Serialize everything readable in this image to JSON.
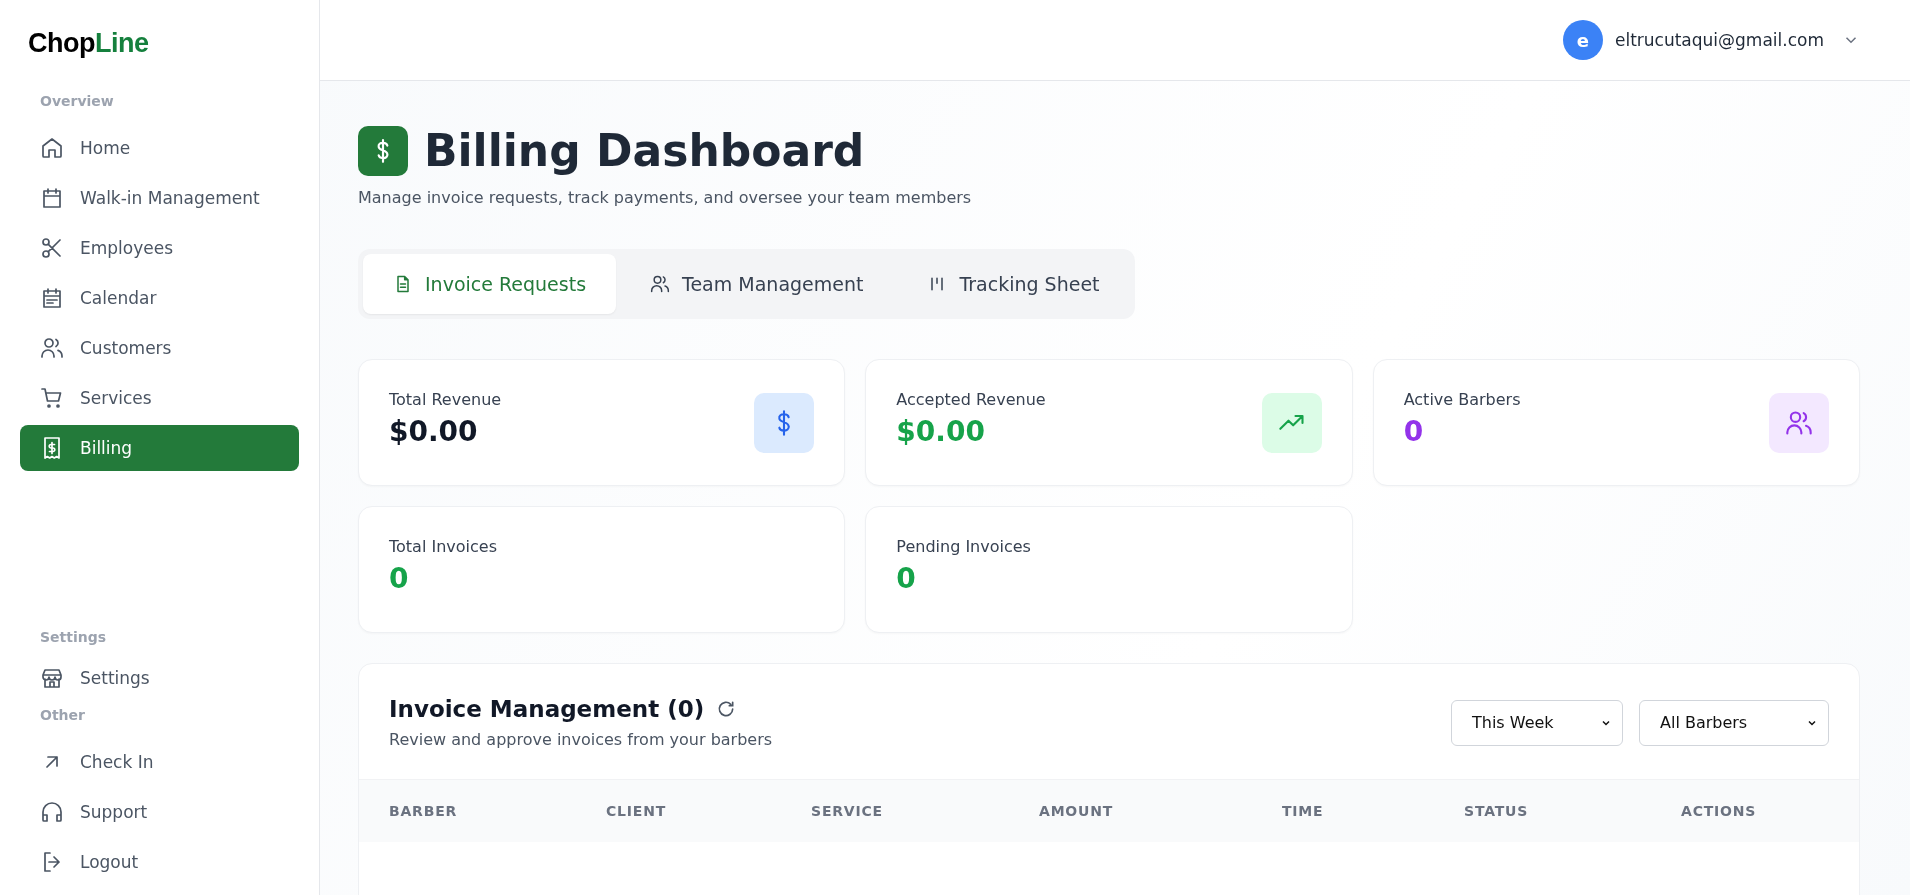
{
  "brand": {
    "name_part_1": "Chop",
    "name_part_2": "Line"
  },
  "sidebar": {
    "sections": [
      {
        "label": "Overview",
        "items": [
          {
            "label": "Home",
            "selected": false
          },
          {
            "label": "Walk-in Management",
            "selected": false
          },
          {
            "label": "Employees",
            "selected": false
          },
          {
            "label": "Calendar",
            "selected": false
          },
          {
            "label": "Customers",
            "selected": false
          },
          {
            "label": "Services",
            "selected": false
          },
          {
            "label": "Billing",
            "selected": true
          }
        ]
      },
      {
        "label": "Settings",
        "items": [
          {
            "label": "Settings",
            "selected": false
          }
        ]
      },
      {
        "label": "Other",
        "items": [
          {
            "label": "Check In",
            "selected": false
          },
          {
            "label": "Support",
            "selected": false
          },
          {
            "label": "Logout",
            "selected": false
          }
        ]
      }
    ]
  },
  "user": {
    "initial": "e",
    "email": "eltrucutaqui@gmail.com"
  },
  "page": {
    "title": "Billing Dashboard",
    "subtitle": "Manage invoice requests, track payments, and oversee your team members"
  },
  "tabs": [
    {
      "label": "Invoice Requests",
      "selected": true
    },
    {
      "label": "Team Management",
      "selected": false
    },
    {
      "label": "Tracking Sheet",
      "selected": false
    }
  ],
  "stats": [
    {
      "kind": "dollar",
      "label": "Total Revenue",
      "value": "$0.00",
      "color": "#111827"
    },
    {
      "kind": "trend",
      "label": "Accepted Revenue",
      "value": "$0.00",
      "color": "#16a34a"
    },
    {
      "kind": "people",
      "label": "Active Barbers",
      "value": "0",
      "color": "#9333ea"
    },
    {
      "kind": "plain",
      "label": "Total Invoices",
      "value": "0",
      "color": "#16a34a"
    },
    {
      "kind": "plain",
      "label": "Pending Invoices",
      "value": "0",
      "color": "#16a34a"
    }
  ],
  "invoices": {
    "title": "Invoice Management (0)",
    "subtitle": "Review and approve invoices from your barbers",
    "filters": [
      {
        "value": "This Week"
      },
      {
        "value": "All Barbers"
      }
    ],
    "columns": [
      "BARBER",
      "CLIENT",
      "SERVICE",
      "AMOUNT",
      "TIME",
      "STATUS",
      "ACTIONS"
    ]
  }
}
